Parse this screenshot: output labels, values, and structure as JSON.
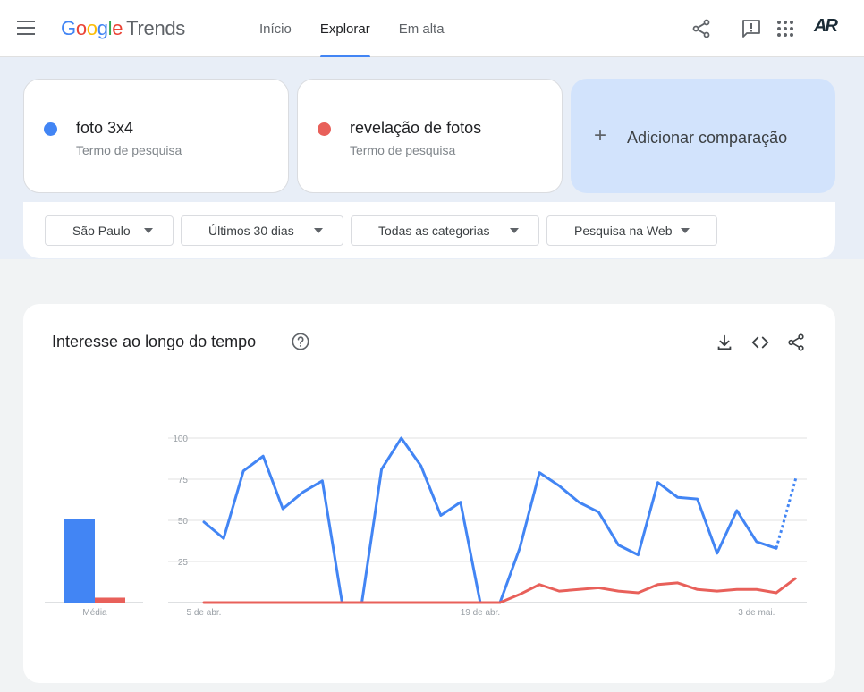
{
  "header": {
    "logo_google": [
      "G",
      "o",
      "o",
      "g",
      "l",
      "e"
    ],
    "logo_trends": "Trends",
    "nav": [
      {
        "label": "Início",
        "active": false
      },
      {
        "label": "Explorar",
        "active": true
      },
      {
        "label": "Em alta",
        "active": false
      }
    ],
    "avatar_text": "AR"
  },
  "terms": [
    {
      "name": "foto 3x4",
      "sub": "Termo de pesquisa",
      "color": "#4285f4"
    },
    {
      "name": "revelação de fotos",
      "sub": "Termo de pesquisa",
      "color": "#e8605a"
    }
  ],
  "add_comparison": {
    "plus": "+",
    "label": "Adicionar comparação"
  },
  "filters": [
    {
      "label": "São Paulo"
    },
    {
      "label": "Últimos 30 dias"
    },
    {
      "label": "Todas as categorias"
    },
    {
      "label": "Pesquisa na Web"
    }
  ],
  "chart_section": {
    "title": "Interesse ao longo do tempo"
  },
  "chart_data": {
    "type": "line",
    "y_ticks": [
      "100",
      "75",
      "50",
      "25"
    ],
    "ylim": [
      0,
      100
    ],
    "x_tick_labels": [
      "5 de abr.",
      "19 de abr.",
      "3 de mai."
    ],
    "x_tick_indices": [
      0,
      14,
      28
    ],
    "average_label": "Média",
    "average_values": [
      51,
      3
    ],
    "partial_from_index": 29,
    "series": [
      {
        "color": "#4285f4",
        "values": [
          49,
          39,
          80,
          89,
          57,
          67,
          74,
          0,
          0,
          81,
          100,
          83,
          53,
          61,
          0,
          0,
          33,
          79,
          71,
          61,
          55,
          35,
          29,
          73,
          64,
          63,
          30,
          56,
          37,
          33,
          76
        ]
      },
      {
        "color": "#e8605a",
        "values": [
          0,
          0,
          0,
          0,
          0,
          0,
          0,
          0,
          0,
          0,
          0,
          0,
          0,
          0,
          0,
          0,
          5,
          11,
          7,
          8,
          9,
          7,
          6,
          11,
          12,
          8,
          7,
          8,
          8,
          6,
          15
        ]
      }
    ]
  }
}
